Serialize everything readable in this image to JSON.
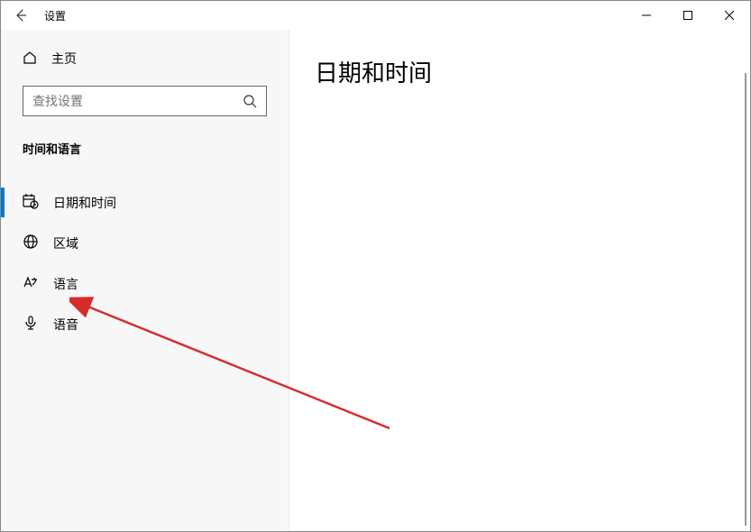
{
  "window": {
    "title": "设置"
  },
  "sidebar": {
    "home": "主页",
    "searchPlaceholder": "查找设置",
    "section": "时间和语言",
    "items": [
      {
        "label": "日期和时间"
      },
      {
        "label": "区域"
      },
      {
        "label": "语言"
      },
      {
        "label": "语音"
      }
    ]
  },
  "page": {
    "title": "日期和时间"
  }
}
